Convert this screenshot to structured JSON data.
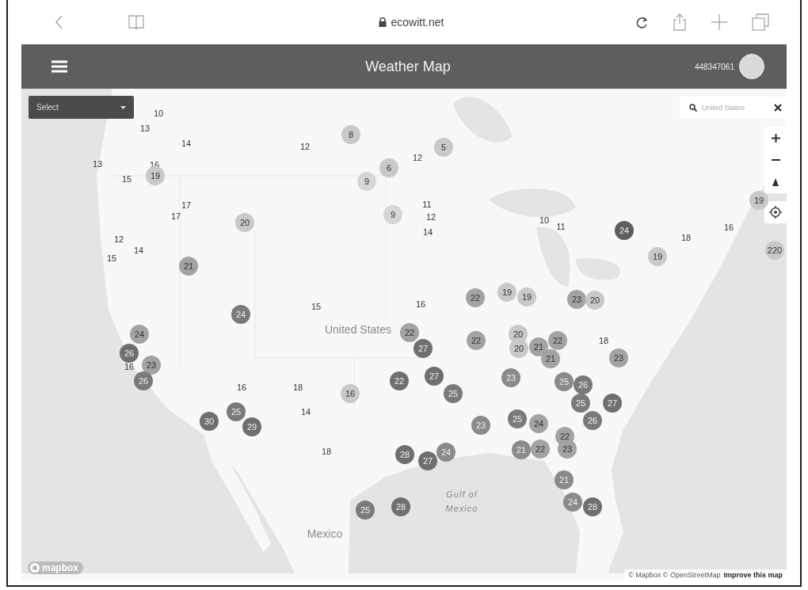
{
  "browser": {
    "url": "ecowitt.net"
  },
  "app_bar": {
    "title": "Weather Map",
    "user_id": "448347061"
  },
  "map": {
    "select": {
      "value": "Select"
    },
    "search": {
      "value": "United States"
    },
    "labels": [
      {
        "text": "United States",
        "kind": "country"
      },
      {
        "text": "Mexico",
        "kind": "country"
      },
      {
        "text": "Gulf of Mexico",
        "kind": "sea"
      }
    ],
    "markers": [
      {
        "text": "10",
        "kind": "plain"
      },
      {
        "text": "14",
        "kind": "plain"
      },
      {
        "text": "13",
        "kind": "plain"
      },
      {
        "text": "13",
        "kind": "plain"
      },
      {
        "text": "16",
        "kind": "plain"
      },
      {
        "text": "15",
        "kind": "plain"
      },
      {
        "text": "19",
        "kind": "dot",
        "color": "#c9c9c9"
      },
      {
        "text": "12",
        "kind": "plain"
      },
      {
        "text": "8",
        "kind": "dot",
        "color": "#c9c9c9"
      },
      {
        "text": "5",
        "kind": "dot",
        "color": "#c9c9c9"
      },
      {
        "text": "6",
        "kind": "dot",
        "color": "#c9c9c9"
      },
      {
        "text": "12",
        "kind": "plain"
      },
      {
        "text": "9",
        "kind": "dot",
        "color": "#d6d6d6"
      },
      {
        "text": "9",
        "kind": "dot",
        "color": "#d6d6d6"
      },
      {
        "text": "11",
        "kind": "plain"
      },
      {
        "text": "12",
        "kind": "plain"
      },
      {
        "text": "14",
        "kind": "plain"
      },
      {
        "text": "17",
        "kind": "plain"
      },
      {
        "text": "17",
        "kind": "plain"
      },
      {
        "text": "20",
        "kind": "dot",
        "color": "#c9c9c9"
      },
      {
        "text": "12",
        "kind": "plain"
      },
      {
        "text": "15",
        "kind": "plain"
      },
      {
        "text": "14",
        "kind": "plain"
      },
      {
        "text": "21",
        "kind": "dot",
        "color": "#a3a3a3"
      },
      {
        "text": "24",
        "kind": "dot",
        "color": "#7a7a7a"
      },
      {
        "text": "15",
        "kind": "plain"
      },
      {
        "text": "16",
        "kind": "plain"
      },
      {
        "text": "22",
        "kind": "dot",
        "color": "#a3a3a3"
      },
      {
        "text": "19",
        "kind": "dot",
        "color": "#c9c9c9"
      },
      {
        "text": "19",
        "kind": "dot",
        "color": "#c9c9c9"
      },
      {
        "text": "10",
        "kind": "plain"
      },
      {
        "text": "11",
        "kind": "plain"
      },
      {
        "text": "24",
        "kind": "dot",
        "color": "#5e5e5e"
      },
      {
        "text": "18",
        "kind": "plain"
      },
      {
        "text": "19",
        "kind": "dot",
        "color": "#c9c9c9"
      },
      {
        "text": "16",
        "kind": "plain"
      },
      {
        "text": "220",
        "kind": "dot",
        "color": "#c9c9c9"
      },
      {
        "text": "19",
        "kind": "dot",
        "color": "#c9c9c9"
      },
      {
        "text": "23",
        "kind": "dot",
        "color": "#a3a3a3"
      },
      {
        "text": "20",
        "kind": "dot",
        "color": "#c9c9c9"
      },
      {
        "text": "22",
        "kind": "dot",
        "color": "#a3a3a3"
      },
      {
        "text": "27",
        "kind": "dot",
        "color": "#6f6f6f"
      },
      {
        "text": "22",
        "kind": "dot",
        "color": "#a3a3a3"
      },
      {
        "text": "20",
        "kind": "dot",
        "color": "#c9c9c9"
      },
      {
        "text": "20",
        "kind": "dot",
        "color": "#c9c9c9"
      },
      {
        "text": "21",
        "kind": "dot",
        "color": "#a3a3a3"
      },
      {
        "text": "22",
        "kind": "dot",
        "color": "#a3a3a3"
      },
      {
        "text": "21",
        "kind": "dot",
        "color": "#a3a3a3"
      },
      {
        "text": "18",
        "kind": "plain"
      },
      {
        "text": "23",
        "kind": "dot",
        "color": "#a3a3a3"
      },
      {
        "text": "22",
        "kind": "dot",
        "color": "#6f6f6f"
      },
      {
        "text": "27",
        "kind": "dot",
        "color": "#6f6f6f"
      },
      {
        "text": "25",
        "kind": "dot",
        "color": "#7a7a7a"
      },
      {
        "text": "23",
        "kind": "dot",
        "color": "#8a8a8a"
      },
      {
        "text": "25",
        "kind": "dot",
        "color": "#8a8a8a"
      },
      {
        "text": "26",
        "kind": "dot",
        "color": "#7a7a7a"
      },
      {
        "text": "25",
        "kind": "dot",
        "color": "#7a7a7a"
      },
      {
        "text": "27",
        "kind": "dot",
        "color": "#6f6f6f"
      },
      {
        "text": "23",
        "kind": "dot",
        "color": "#8a8a8a"
      },
      {
        "text": "25",
        "kind": "dot",
        "color": "#7a7a7a"
      },
      {
        "text": "24",
        "kind": "dot",
        "color": "#a3a3a3"
      },
      {
        "text": "26",
        "kind": "dot",
        "color": "#7a7a7a"
      },
      {
        "text": "22",
        "kind": "dot",
        "color": "#a3a3a3"
      },
      {
        "text": "28",
        "kind": "dot",
        "color": "#6f6f6f"
      },
      {
        "text": "27",
        "kind": "dot",
        "color": "#6f6f6f"
      },
      {
        "text": "24",
        "kind": "dot",
        "color": "#8a8a8a"
      },
      {
        "text": "21",
        "kind": "dot",
        "color": "#8a8a8a"
      },
      {
        "text": "22",
        "kind": "dot",
        "color": "#a3a3a3"
      },
      {
        "text": "23",
        "kind": "dot",
        "color": "#a3a3a3"
      },
      {
        "text": "21",
        "kind": "dot",
        "color": "#8a8a8a"
      },
      {
        "text": "25",
        "kind": "dot",
        "color": "#7a7a7a"
      },
      {
        "text": "28",
        "kind": "dot",
        "color": "#6f6f6f"
      },
      {
        "text": "24",
        "kind": "dot",
        "color": "#8a8a8a"
      },
      {
        "text": "28",
        "kind": "dot",
        "color": "#6f6f6f"
      },
      {
        "text": "16",
        "kind": "dot",
        "color": "#c9c9c9"
      },
      {
        "text": "16",
        "kind": "plain"
      },
      {
        "text": "18",
        "kind": "plain"
      },
      {
        "text": "14",
        "kind": "plain"
      },
      {
        "text": "18",
        "kind": "plain"
      },
      {
        "text": "30",
        "kind": "dot",
        "color": "#6f6f6f"
      },
      {
        "text": "25",
        "kind": "dot",
        "color": "#7a7a7a"
      },
      {
        "text": "29",
        "kind": "dot",
        "color": "#6f6f6f"
      },
      {
        "text": "24",
        "kind": "dot",
        "color": "#a3a3a3"
      },
      {
        "text": "26",
        "kind": "dot",
        "color": "#6f6f6f"
      },
      {
        "text": "16",
        "kind": "plain"
      },
      {
        "text": "23",
        "kind": "dot",
        "color": "#a3a3a3"
      },
      {
        "text": "26",
        "kind": "dot",
        "color": "#7a7a7a"
      }
    ],
    "logo": "mapbox",
    "attribution": "© Mapbox © OpenStreetMap",
    "improve_link": "Improve this map"
  }
}
